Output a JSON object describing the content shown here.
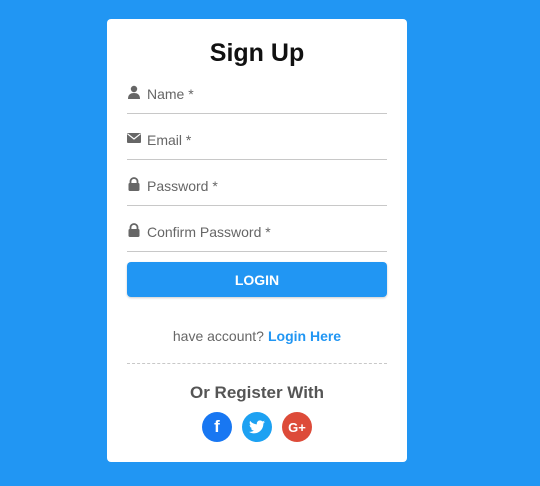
{
  "form": {
    "title": "Sign Up",
    "fields": [
      {
        "placeholder": "Name *",
        "icon": "user-icon"
      },
      {
        "placeholder": "Email *",
        "icon": "envelope-icon"
      },
      {
        "placeholder": "Password *",
        "icon": "lock-icon"
      },
      {
        "placeholder": "Confirm Password *",
        "icon": "lock-icon"
      }
    ],
    "submit_label": "LOGIN",
    "account_text": "have account?",
    "login_link": "Login Here",
    "or_register": "Or Register With"
  },
  "social": {
    "facebook": {
      "label": "f",
      "color": "#1877f2"
    },
    "twitter": {
      "color": "#1da1f2"
    },
    "google": {
      "label": "G+",
      "color": "#dd4b39"
    }
  },
  "colors": {
    "background": "#2196f3",
    "accent": "#2196f3",
    "card": "#ffffff"
  }
}
